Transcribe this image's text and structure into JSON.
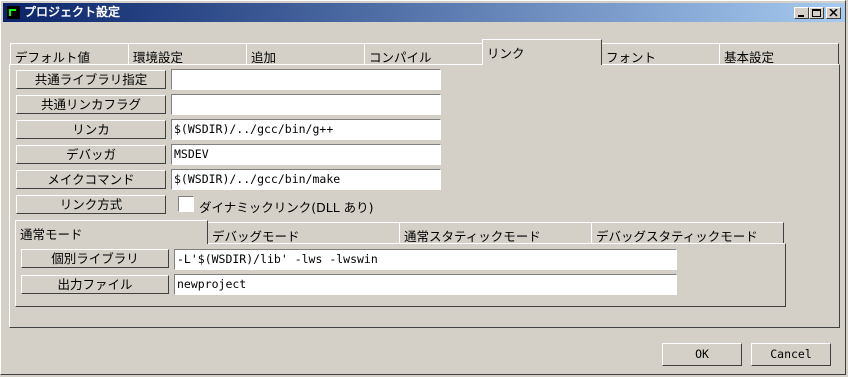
{
  "window": {
    "title": "プロジェクト設定"
  },
  "tabs": [
    "デフォルト値",
    "環境設定",
    "追加",
    "コンパイル",
    "リンク",
    "フォント",
    "基本設定"
  ],
  "link_settings": {
    "common_library": {
      "label": "共通ライブラリ指定",
      "value": ""
    },
    "common_link_flags": {
      "label": "共通リンカフラグ",
      "value": ""
    },
    "linker": {
      "label": "リンカ",
      "value": "$(WSDIR)/../gcc/bin/g++"
    },
    "debugger": {
      "label": "デバッガ",
      "value": "MSDEV"
    },
    "make_command": {
      "label": "メイクコマンド",
      "value": "$(WSDIR)/../gcc/bin/make"
    },
    "link_method": {
      "label": "リンク方式",
      "checkbox_label": "ダイナミックリンク(DLL あり)",
      "checked": false
    }
  },
  "mode_tabs": [
    "通常モード",
    "デバッグモード",
    "通常スタティックモード",
    "デバッグスタティックモード"
  ],
  "mode_settings": {
    "individual_library": {
      "label": "個別ライブラリ",
      "value": "-L'$(WSDIR)/lib' -lws -lwswin"
    },
    "output_file": {
      "label": "出力ファイル",
      "value": "newproject"
    }
  },
  "buttons": {
    "ok": "OK",
    "cancel": "Cancel"
  }
}
